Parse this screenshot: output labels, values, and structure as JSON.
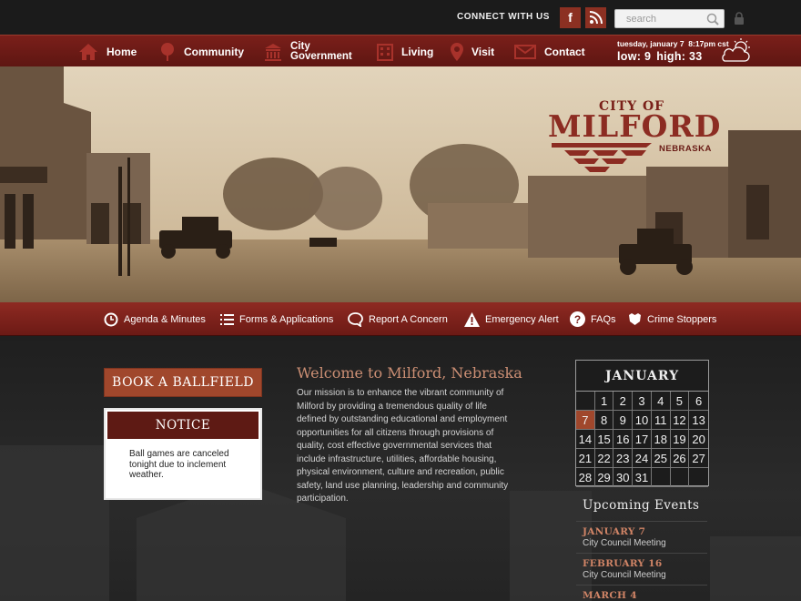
{
  "header": {
    "connect_label": "CONNECT WITH US",
    "social": [
      {
        "name": "facebook-icon",
        "glyph": "f"
      },
      {
        "name": "rss-icon",
        "glyph": "rss"
      }
    ],
    "search_placeholder": "search"
  },
  "nav": {
    "items": [
      {
        "label": "Home",
        "icon": "home-icon"
      },
      {
        "label": "Community",
        "icon": "tree-icon"
      },
      {
        "label": "City",
        "label2": "Government",
        "icon": "capitol-icon"
      },
      {
        "label": "Living",
        "icon": "building-icon"
      },
      {
        "label": "Visit",
        "icon": "map-pin-icon"
      },
      {
        "label": "Contact",
        "icon": "envelope-icon"
      }
    ]
  },
  "weather": {
    "date": "tuesday, january 7",
    "time": "8:17pm cst",
    "low": "low: 9",
    "high": "high: 33",
    "icon": "partly-cloudy-icon"
  },
  "logo": {
    "city_of": "CITY OF",
    "name": "MILFORD",
    "state": "NEBRASKA"
  },
  "quick_links": [
    {
      "label": "Agenda & Minutes",
      "icon": "clock-icon"
    },
    {
      "label": "Forms & Applications",
      "icon": "list-icon"
    },
    {
      "label": "Report A Concern",
      "icon": "speech-bubble-icon"
    },
    {
      "label": "Emergency Alert",
      "icon": "warning-icon"
    },
    {
      "label": "FAQs",
      "icon": "question-icon"
    },
    {
      "label": "Crime Stoppers",
      "icon": "badge-icon"
    }
  ],
  "sidebar": {
    "book_label": "BOOK A BALLFIELD",
    "notice_title": "NOTICE",
    "notice_text": "Ball games are canceled tonight due to inclement weather."
  },
  "welcome": {
    "title": "Welcome to Milford, Nebraska",
    "text": "Our mission is to enhance the vibrant community of Milford by providing a tremendous quality of life defined by outstanding educational and employment opportunities for all citizens through provisions of quality, cost effective governmental services that include infrastructure, utilities, affordable housing, physical environment, culture and recreation, public safety, land use planning, leadership and community participation."
  },
  "calendar": {
    "month": "JANUARY",
    "days": [
      "",
      "1",
      "2",
      "3",
      "4",
      "5",
      "6",
      "7",
      "8",
      "9",
      "10",
      "11",
      "12",
      "13",
      "14",
      "15",
      "16",
      "17",
      "18",
      "19",
      "20",
      "21",
      "22",
      "23",
      "24",
      "25",
      "26",
      "27",
      "28",
      "29",
      "30",
      "31",
      "",
      "",
      ""
    ],
    "today": "7"
  },
  "events": {
    "title": "Upcoming Events",
    "items": [
      {
        "date": "JANUARY 7",
        "name": "City Council Meeting"
      },
      {
        "date": "FEBRUARY 16",
        "name": "City Council Meeting"
      },
      {
        "date": "MARCH 4",
        "name": ""
      }
    ]
  },
  "colors": {
    "brand_red": "#7a1f1a",
    "accent_rust": "#a0472c",
    "event_date": "#d08466"
  }
}
